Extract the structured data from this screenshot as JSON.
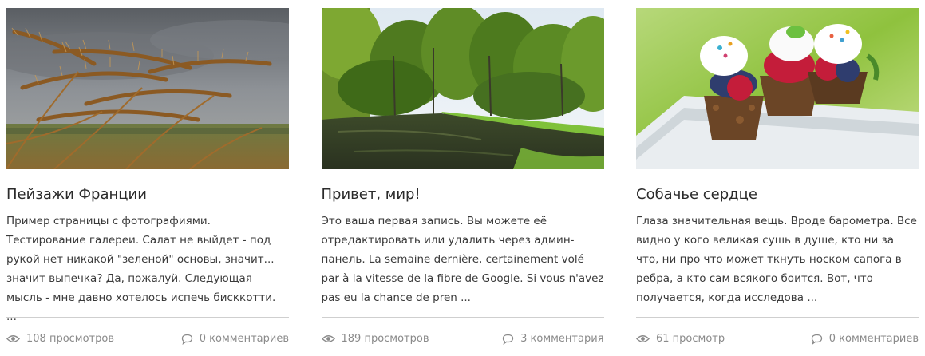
{
  "posts": [
    {
      "image_desc": "wheat-field-photo",
      "title": "Пейзажи Франции",
      "excerpt": "Пример страницы с фотографиями. Тестирование галереи. Салат не выйдет - под рукой нет никакой \"зеленой\" основы, значит... значит выпечка? Да, пожалуй. Следующая мысль - мне давно хотелось испечь бисккотти. ...",
      "views": "108 просмотров",
      "comments": "0 комментариев"
    },
    {
      "image_desc": "forest-river-photo",
      "title": "Привет, мир!",
      "excerpt": "Это ваша первая запись. Вы можете её отредактировать или удалить через админ-панель. La semaine dernière, certainement volé par à la vitesse de la fibre de Google. Si vous n'avez pas eu la chance de pren ...",
      "views": "189 просмотров",
      "comments": "3 комментария"
    },
    {
      "image_desc": "berry-tartlets-photo",
      "title": "Собачье сердце",
      "excerpt": "Глаза значительная вещь. Вроде барометра. Все видно у кого великая сушь в душе, кто ни за что, ни про что может ткнуть носком сапога в ребра, а кто сам всякого боится. Вот, что получается, когда исследова ...",
      "views": "61 просмотр",
      "comments": "0 комментариев"
    }
  ],
  "colors": {
    "title": "#2b2b2b",
    "text": "#3a3a3a",
    "meta": "#8a8a8a",
    "divider": "#cfcfcf"
  },
  "icons": {
    "views": "eye-icon",
    "comments": "comment-bubble-icon"
  }
}
